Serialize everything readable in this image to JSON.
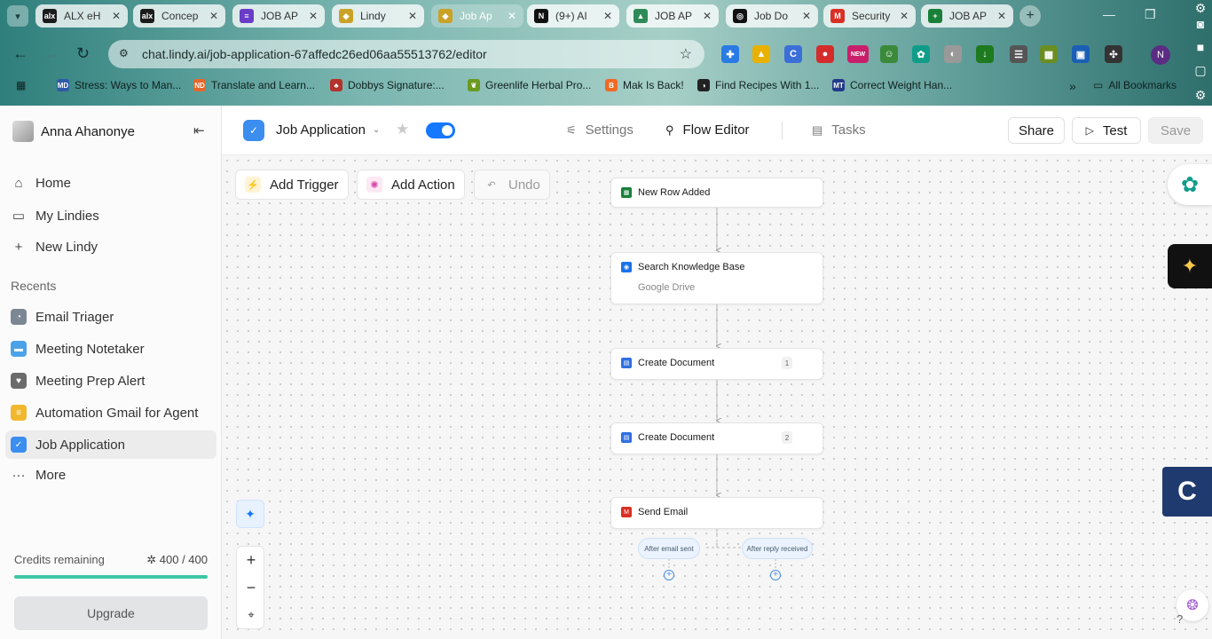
{
  "browser": {
    "tabs": [
      {
        "label": "ALX eH",
        "fav": "alx",
        "color": "#1b1b1b"
      },
      {
        "label": "Concep",
        "fav": "alx",
        "color": "#1b1b1b"
      },
      {
        "label": "JOB AP",
        "fav": "≡",
        "color": "#6a3cc8"
      },
      {
        "label": "Lindy",
        "fav": "◆",
        "color": "#c9a227"
      },
      {
        "label": "Job Ap",
        "fav": "◆",
        "color": "#c9a227"
      },
      {
        "label": "(9+) AI",
        "fav": "N",
        "color": "#111111"
      },
      {
        "label": "JOB AP",
        "fav": "▲",
        "color": "#2e8b57"
      },
      {
        "label": "Job Do",
        "fav": "◎",
        "color": "#111111"
      },
      {
        "label": "Security",
        "fav": "M",
        "color": "#d93025"
      },
      {
        "label": "JOB AP",
        "fav": "+",
        "color": "#188038"
      }
    ],
    "url": "chat.lindy.ai/job-application-67affedc26ed06aa55513762/editor",
    "extensions": [
      {
        "glyph": "✚",
        "color": "#2a7ae4"
      },
      {
        "glyph": "▲",
        "color": "#e8b100"
      },
      {
        "glyph": "C",
        "color": "#3b6fd8"
      },
      {
        "glyph": "●",
        "color": "#d42b2b"
      },
      {
        "glyph": "NEW",
        "color": "#c91f6a"
      },
      {
        "glyph": "☺",
        "color": "#3a8a3a"
      },
      {
        "glyph": "✿",
        "color": "#0f9d8a"
      },
      {
        "glyph": "◐",
        "color": "#999999"
      },
      {
        "glyph": "↓",
        "color": "#1e7a1e"
      },
      {
        "glyph": "☰",
        "color": "#555555"
      },
      {
        "glyph": "▦",
        "color": "#6b8e23"
      },
      {
        "glyph": "▣",
        "color": "#1a5fb4"
      },
      {
        "glyph": "✣",
        "color": "#333333"
      }
    ],
    "profile_initial": "N",
    "bookmarks": [
      {
        "label": "Stress: Ways to Man...",
        "icon": "MD",
        "color": "#2f5aa8"
      },
      {
        "label": "Translate and Learn...",
        "icon": "ND",
        "color": "#e5672a"
      },
      {
        "label": "Dobbys Signature:...",
        "icon": "♣",
        "color": "#b3322b"
      },
      {
        "label": "Greenlife Herbal Pro...",
        "icon": "❦",
        "color": "#6a9a1f"
      },
      {
        "label": "Mak Is Back!",
        "icon": "B",
        "color": "#f06a23"
      },
      {
        "label": "Find Recipes With 1...",
        "icon": "◑",
        "color": "#222222"
      },
      {
        "label": "Correct Weight Han...",
        "icon": "MT",
        "color": "#233a8a"
      }
    ],
    "bookmarks_more": "»",
    "all_bookmarks": "All Bookmarks"
  },
  "sidebar": {
    "user_name": "Anna Ahanonye",
    "nav": [
      {
        "label": "Home",
        "icon": "⌂"
      },
      {
        "label": "My Lindies",
        "icon": "▭"
      },
      {
        "label": "New Lindy",
        "icon": "+"
      }
    ],
    "recents_heading": "Recents",
    "recents": [
      {
        "label": "Email Triager",
        "color": "#7c8794",
        "glyph": "◔"
      },
      {
        "label": "Meeting Notetaker",
        "color": "#4aa3e8",
        "glyph": "▬"
      },
      {
        "label": "Meeting Prep Alert",
        "color": "#6b6b6b",
        "glyph": "♥"
      },
      {
        "label": "Automation Gmail for Agent",
        "color": "#f1b82d",
        "glyph": "≡"
      },
      {
        "label": "Job Application",
        "color": "#3b8df0",
        "glyph": "✓"
      }
    ],
    "more_label": "More",
    "credits_label": "Credits remaining",
    "credits_value": "400 / 400",
    "credits_fraction": 1.0,
    "upgrade_label": "Upgrade"
  },
  "topbar": {
    "title": "Job Application",
    "tabs": [
      {
        "label": "Settings",
        "icon": "⚟"
      },
      {
        "label": "Flow Editor",
        "icon": "⚲"
      },
      {
        "label": "Tasks",
        "icon": "▤"
      }
    ],
    "share_label": "Share",
    "test_label": "Test",
    "save_label": "Save",
    "enabled": true
  },
  "canvas": {
    "add_trigger": "Add Trigger",
    "add_action": "Add Action",
    "undo": "Undo",
    "nodes": [
      {
        "title": "New Row Added",
        "subtitle": "",
        "badge": "",
        "icon": "▦",
        "color": "#188038"
      },
      {
        "title": "Search Knowledge Base",
        "subtitle": "Google Drive",
        "badge": "",
        "icon": "◉",
        "color": "#1a73e8"
      },
      {
        "title": "Create Document",
        "subtitle": "",
        "badge": "1",
        "icon": "▤",
        "color": "#2f6fe0"
      },
      {
        "title": "Create Document",
        "subtitle": "",
        "badge": "2",
        "icon": "▤",
        "color": "#2f6fe0"
      },
      {
        "title": "Send Email",
        "subtitle": "",
        "badge": "",
        "icon": "M",
        "color": "#d93025"
      }
    ],
    "branches": [
      "After email sent",
      "After reply received"
    ]
  }
}
